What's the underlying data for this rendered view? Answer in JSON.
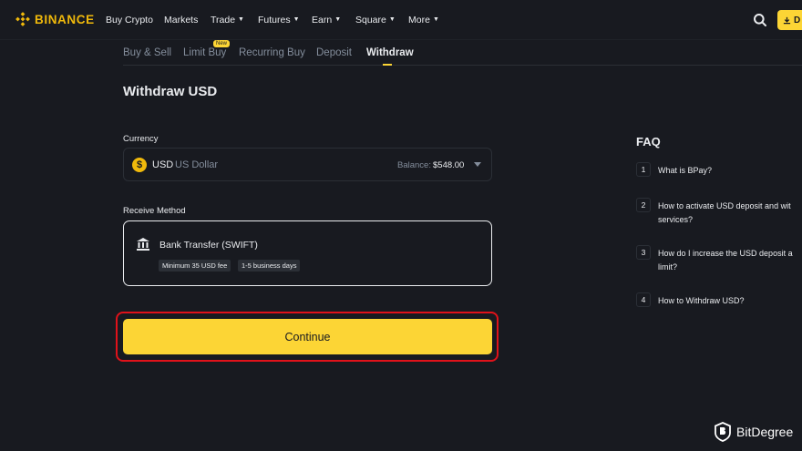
{
  "header": {
    "brand": "BINANCE",
    "nav": [
      "Buy Crypto",
      "Markets",
      "Trade",
      "Futures",
      "Earn",
      "Square",
      "More"
    ],
    "nav_dropdown": [
      false,
      false,
      true,
      true,
      true,
      true,
      true
    ],
    "download_label": "D",
    "brand_color": "#f0b90b",
    "accent_color": "#fcd535"
  },
  "subnav": {
    "tabs": [
      "Buy & Sell",
      "Limit Buy",
      "Recurring Buy",
      "Deposit",
      "Withdraw"
    ],
    "active": "Withdraw",
    "new_badge": "New"
  },
  "page": {
    "title": "Withdraw USD"
  },
  "currency": {
    "label": "Currency",
    "code": "USD",
    "name": "US Dollar",
    "icon": "dollar-coin-icon",
    "balance_label": "Balance:",
    "balance_value": "$548.00"
  },
  "receive_method": {
    "label": "Receive Method",
    "name": "Bank Transfer (SWIFT)",
    "icon": "bank-icon",
    "tags": [
      "Minimum 35 USD fee",
      "1-5 business days"
    ]
  },
  "continue_label": "Continue",
  "faq": {
    "title": "FAQ",
    "items": [
      {
        "num": "1",
        "text": "What is BPay?"
      },
      {
        "num": "2",
        "text": "How to activate USD deposit and wit\nservices?"
      },
      {
        "num": "3",
        "text": "How do I increase the USD deposit a\nlimit?"
      },
      {
        "num": "4",
        "text": "How to Withdraw USD?"
      }
    ]
  },
  "watermark": "BitDegree"
}
